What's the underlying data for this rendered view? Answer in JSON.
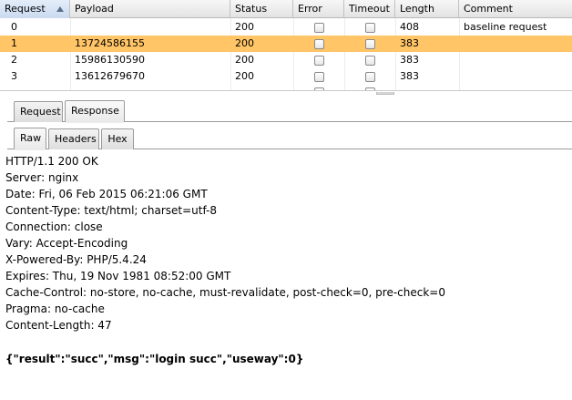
{
  "table": {
    "columns": [
      {
        "label": "Request",
        "sorted": true
      },
      {
        "label": "Payload"
      },
      {
        "label": "Status"
      },
      {
        "label": "Error"
      },
      {
        "label": "Timeout"
      },
      {
        "label": "Length"
      },
      {
        "label": "Comment"
      }
    ],
    "rows": [
      {
        "request": "0",
        "payload": "",
        "status": "200",
        "error": false,
        "timeout": false,
        "length": "408",
        "comment": "baseline request",
        "selected": false
      },
      {
        "request": "1",
        "payload": "13724586155",
        "status": "200",
        "error": false,
        "timeout": false,
        "length": "383",
        "comment": "",
        "selected": true
      },
      {
        "request": "2",
        "payload": "15986130590",
        "status": "200",
        "error": false,
        "timeout": false,
        "length": "383",
        "comment": "",
        "selected": false
      },
      {
        "request": "3",
        "payload": "13612679670",
        "status": "200",
        "error": false,
        "timeout": false,
        "length": "383",
        "comment": "",
        "selected": false
      }
    ]
  },
  "message_tabs": [
    {
      "label": "Request",
      "active": false
    },
    {
      "label": "Response",
      "active": true
    }
  ],
  "view_tabs": [
    {
      "label": "Raw",
      "active": true
    },
    {
      "label": "Headers",
      "active": false
    },
    {
      "label": "Hex",
      "active": false
    }
  ],
  "response": {
    "headers": [
      "HTTP/1.1 200 OK",
      "Server: nginx",
      "Date: Fri, 06 Feb 2015 06:21:06 GMT",
      "Content-Type: text/html; charset=utf-8",
      "Connection: close",
      "Vary: Accept-Encoding",
      "X-Powered-By: PHP/5.4.24",
      "Expires: Thu, 19 Nov 1981 08:52:00 GMT",
      "Cache-Control: no-store, no-cache, must-revalidate, post-check=0, pre-check=0",
      "Pragma: no-cache",
      "Content-Length: 47"
    ],
    "body": "{\"result\":\"succ\",\"msg\":\"login succ\",\"useway\":0}"
  },
  "colors": {
    "selected_row": "#ffc566",
    "header_bg": "#e3e3e3"
  }
}
